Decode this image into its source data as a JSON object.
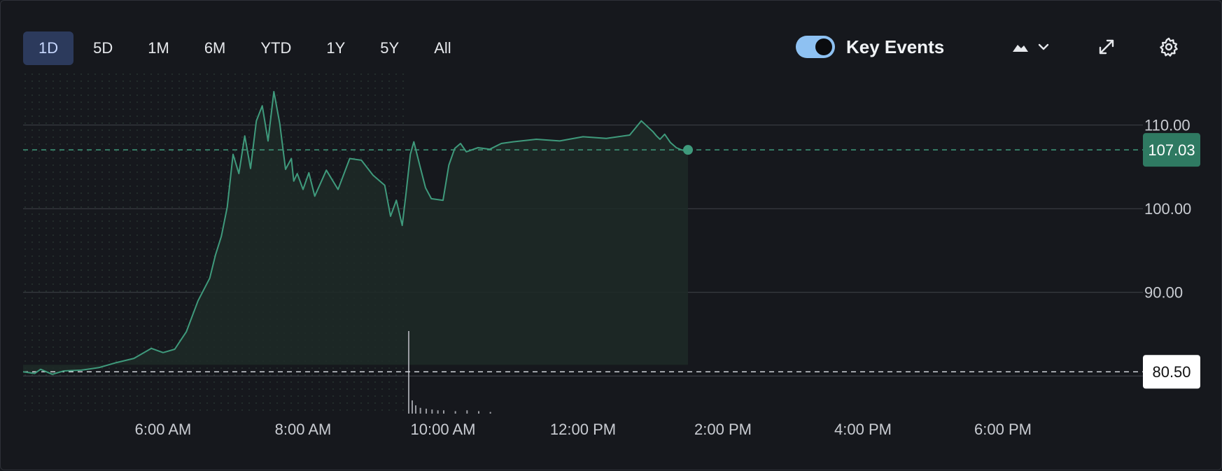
{
  "toolbar": {
    "ranges": [
      "1D",
      "5D",
      "1M",
      "6M",
      "YTD",
      "1Y",
      "5Y",
      "All"
    ],
    "active_range": "1D",
    "key_events_label": "Key Events",
    "key_events_on": true,
    "icons": [
      "area-chart-icon",
      "chevron-down-icon",
      "expand-icon",
      "settings-gear-icon"
    ]
  },
  "colors": {
    "line": "#3f9a7c",
    "fill": "#1d2a27",
    "last_price_badge": "#2f7a62",
    "prev_close_badge": "#ffffff",
    "grid": "#3b3e45",
    "text": "#c9ccd2",
    "volume": "#9a9ca2"
  },
  "chart_data": {
    "type": "line",
    "x_axis": {
      "tick_labels": [
        "6:00 AM",
        "8:00 AM",
        "10:00 AM",
        "12:00 PM",
        "2:00 PM",
        "4:00 PM",
        "6:00 PM"
      ],
      "range": [
        "4:00 AM",
        "8:00 PM"
      ],
      "premarket_end": "9:30 AM"
    },
    "y_axis": {
      "tick_labels": [
        "110.00",
        "100.00",
        "90.00"
      ],
      "ticks": [
        110,
        100,
        90
      ],
      "range": [
        75.5,
        116.5
      ]
    },
    "last_price": 107.03,
    "last_price_label": "107.03",
    "previous_close": 80.5,
    "previous_close_label": "80.50",
    "series": [
      {
        "x": [
          "4:00 AM",
          "4:10 AM",
          "4:15 AM",
          "4:25 AM",
          "4:35 AM",
          "4:50 AM",
          "5:05 AM",
          "5:20 AM",
          "5:35 AM",
          "5:50 AM",
          "6:00 AM",
          "6:10 AM",
          "6:20 AM",
          "6:30 AM",
          "6:40 AM",
          "6:45 AM",
          "6:50 AM",
          "6:55 AM",
          "7:00 AM",
          "7:05 AM",
          "7:10 AM",
          "7:15 AM",
          "7:20 AM",
          "7:25 AM",
          "7:30 AM",
          "7:35 AM",
          "7:40 AM",
          "7:45 AM",
          "7:50 AM",
          "7:52 AM",
          "7:55 AM",
          "8:00 AM",
          "8:05 AM",
          "8:10 AM",
          "8:20 AM",
          "8:30 AM",
          "8:40 AM",
          "8:50 AM",
          "9:00 AM",
          "9:10 AM",
          "9:15 AM",
          "9:20 AM",
          "9:25 AM",
          "9:28 AM",
          "9:32 AM",
          "9:35 AM",
          "9:40 AM",
          "9:45 AM",
          "9:50 AM",
          "10:00 AM",
          "10:05 AM",
          "10:10 AM",
          "10:15 AM",
          "10:20 AM",
          "10:30 AM",
          "10:40 AM",
          "10:50 AM",
          "11:00 AM",
          "11:20 AM",
          "11:40 AM",
          "12:00 PM",
          "12:20 PM",
          "12:40 PM",
          "12:50 PM",
          "1:00 PM",
          "1:03 PM",
          "1:06 PM",
          "1:10 PM",
          "1:15 PM",
          "1:20 PM",
          "1:25 PM",
          "1:30 PM"
        ],
        "values": [
          80.5,
          80.3,
          80.8,
          80.2,
          80.6,
          80.7,
          81.0,
          81.6,
          82.1,
          83.3,
          82.8,
          83.2,
          85.3,
          89.0,
          91.7,
          94.5,
          96.7,
          100.2,
          106.5,
          104.2,
          108.7,
          104.8,
          110.5,
          112.3,
          108.1,
          114.0,
          110.2,
          104.7,
          106.0,
          103.3,
          104.2,
          102.3,
          104.3,
          101.5,
          104.6,
          102.3,
          106.0,
          105.8,
          104.0,
          102.8,
          99.1,
          101.0,
          98.0,
          101.5,
          106.5,
          108.0,
          105.2,
          102.5,
          101.2,
          101.0,
          105.2,
          107.2,
          107.8,
          106.8,
          107.3,
          107.1,
          107.8,
          108.0,
          108.3,
          108.1,
          108.6,
          108.4,
          108.8,
          110.5,
          109.2,
          108.7,
          108.3,
          108.9,
          107.9,
          107.3,
          107.0,
          107.03
        ]
      }
    ],
    "volume": {
      "x": [
        "9:30 AM",
        "9:33 AM",
        "9:36 AM",
        "9:40 AM",
        "9:45 AM",
        "9:50 AM",
        "9:55 AM",
        "10:00 AM",
        "10:10 AM",
        "10:20 AM",
        "10:30 AM",
        "10:40 AM"
      ],
      "values": [
        100,
        16,
        10,
        7,
        6,
        5,
        4,
        4,
        3,
        4,
        3,
        2
      ]
    }
  }
}
